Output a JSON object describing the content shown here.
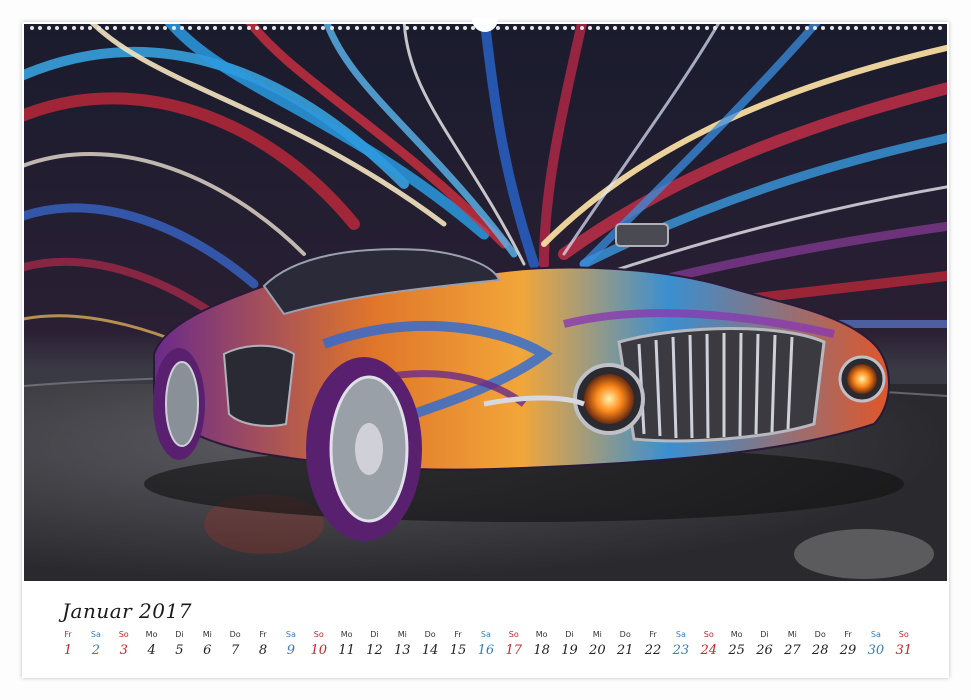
{
  "calendar": {
    "month_label": "Januar 2017",
    "days": [
      {
        "weekday": "Fr",
        "day": "1",
        "kind": "hol"
      },
      {
        "weekday": "Sa",
        "day": "2",
        "kind": "sat"
      },
      {
        "weekday": "So",
        "day": "3",
        "kind": "sun"
      },
      {
        "weekday": "Mo",
        "day": "4",
        "kind": "wk"
      },
      {
        "weekday": "Di",
        "day": "5",
        "kind": "wk"
      },
      {
        "weekday": "Mi",
        "day": "6",
        "kind": "wk"
      },
      {
        "weekday": "Do",
        "day": "7",
        "kind": "wk"
      },
      {
        "weekday": "Fr",
        "day": "8",
        "kind": "wk"
      },
      {
        "weekday": "Sa",
        "day": "9",
        "kind": "sat"
      },
      {
        "weekday": "So",
        "day": "10",
        "kind": "sun"
      },
      {
        "weekday": "Mo",
        "day": "11",
        "kind": "wk"
      },
      {
        "weekday": "Di",
        "day": "12",
        "kind": "wk"
      },
      {
        "weekday": "Mi",
        "day": "13",
        "kind": "wk"
      },
      {
        "weekday": "Do",
        "day": "14",
        "kind": "wk"
      },
      {
        "weekday": "Fr",
        "day": "15",
        "kind": "wk"
      },
      {
        "weekday": "Sa",
        "day": "16",
        "kind": "sat"
      },
      {
        "weekday": "So",
        "day": "17",
        "kind": "sun"
      },
      {
        "weekday": "Mo",
        "day": "18",
        "kind": "wk"
      },
      {
        "weekday": "Di",
        "day": "19",
        "kind": "wk"
      },
      {
        "weekday": "Mi",
        "day": "20",
        "kind": "wk"
      },
      {
        "weekday": "Do",
        "day": "21",
        "kind": "wk"
      },
      {
        "weekday": "Fr",
        "day": "22",
        "kind": "wk"
      },
      {
        "weekday": "Sa",
        "day": "23",
        "kind": "sat"
      },
      {
        "weekday": "So",
        "day": "24",
        "kind": "sun"
      },
      {
        "weekday": "Mo",
        "day": "25",
        "kind": "wk"
      },
      {
        "weekday": "Di",
        "day": "26",
        "kind": "wk"
      },
      {
        "weekday": "Mi",
        "day": "27",
        "kind": "wk"
      },
      {
        "weekday": "Do",
        "day": "28",
        "kind": "wk"
      },
      {
        "weekday": "Fr",
        "day": "29",
        "kind": "wk"
      },
      {
        "weekday": "Sa",
        "day": "30",
        "kind": "sat"
      },
      {
        "weekday": "So",
        "day": "31",
        "kind": "sun"
      }
    ]
  },
  "photo": {
    "subject": "car-in-light-tunnel-image"
  },
  "colors": {
    "saturday": "#3a7bb8",
    "sunday_holiday": "#c8232c",
    "weekday": "#222222"
  }
}
